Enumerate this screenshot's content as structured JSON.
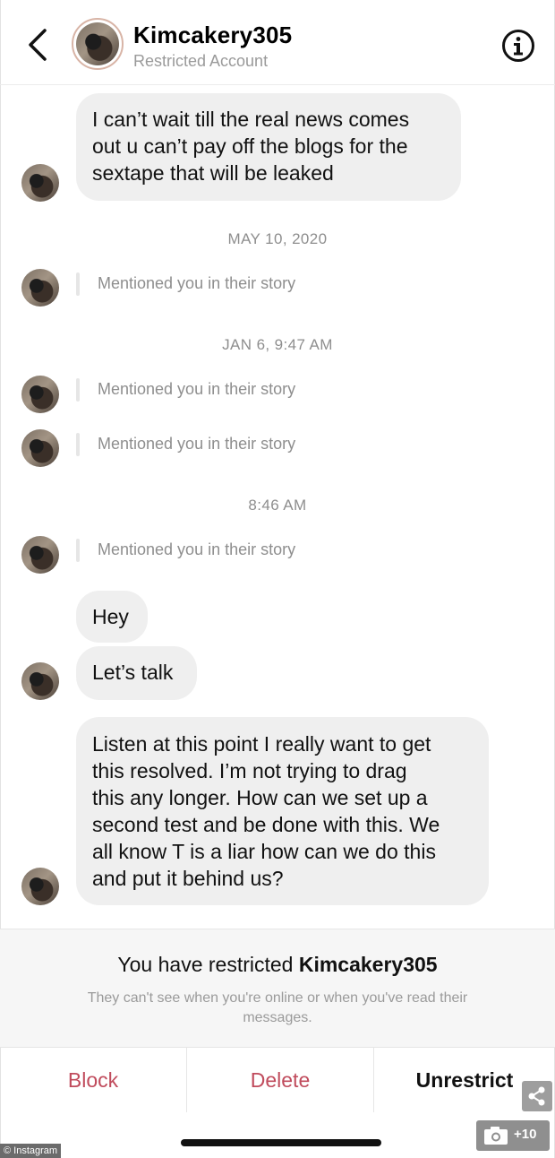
{
  "header": {
    "username": "Kimcakery305",
    "subtitle": "Restricted Account",
    "back_icon": "chevron-left-icon",
    "info_icon": "info-icon"
  },
  "messages": [
    {
      "type": "bubble",
      "text": "I can’t wait till the real news comes\nout u can’t pay off the blogs for the\nsextape that will be leaked"
    },
    {
      "type": "timestamp",
      "text": "MAY 10, 2020"
    },
    {
      "type": "mention",
      "text": "Mentioned you in their story"
    },
    {
      "type": "timestamp",
      "text": "JAN 6, 9:47 AM"
    },
    {
      "type": "mention",
      "text": "Mentioned you in their story"
    },
    {
      "type": "mention",
      "text": "Mentioned you in their story"
    },
    {
      "type": "timestamp",
      "text": "8:46 AM"
    },
    {
      "type": "mention",
      "text": "Mentioned you in their story"
    },
    {
      "type": "bubble",
      "text": "Hey"
    },
    {
      "type": "bubble",
      "text": "Let’s talk"
    },
    {
      "type": "bubble",
      "text": "Listen at this point I really want to get\nthis resolved. I’m not trying to drag\nthis any longer. How can we set up a\nsecond test and be done with this. We\nall know T is a liar how can we do this\nand put it behind us?"
    }
  ],
  "restricted_notice": {
    "prefix": "You have restricted ",
    "username": "Kimcakery305",
    "description": "They can't see when you're online or when you've read their messages."
  },
  "actions": {
    "block": "Block",
    "delete": "Delete",
    "unrestrict": "Unrestrict"
  },
  "overlay": {
    "gallery_count": "+10",
    "credit": "© Instagram",
    "share_icon": "share-icon",
    "camera_icon": "camera-icon"
  },
  "colors": {
    "bubble": "#efefef",
    "destructive": "#c04b5c",
    "muted_text": "#8e8e8e"
  }
}
